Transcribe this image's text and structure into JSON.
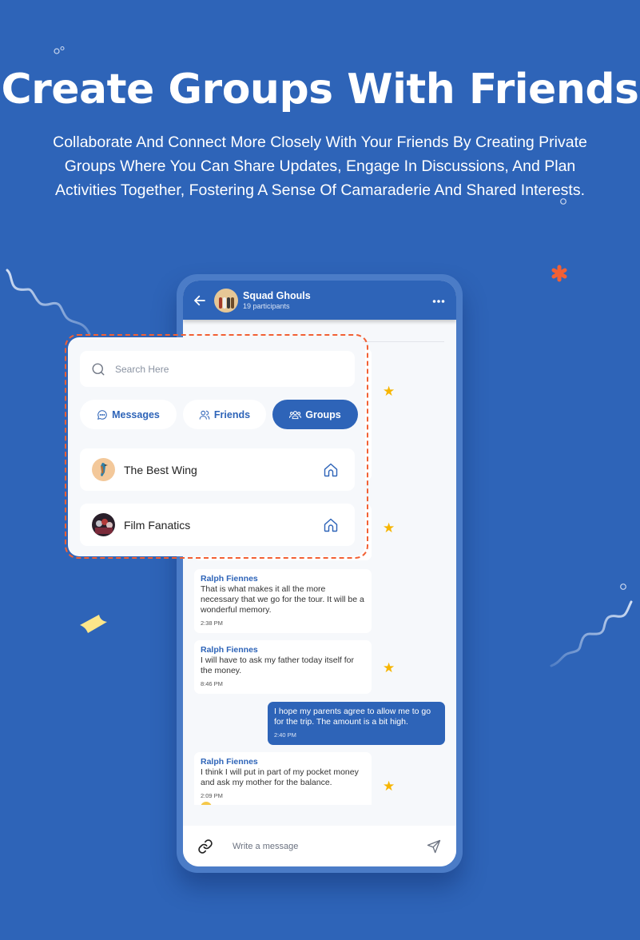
{
  "hero": {
    "title": "Create Groups With Friends",
    "subtitle": "Collaborate And Connect More Closely With Your Friends By Creating Private Groups Where You Can Share Updates, Engage In Discussions, And Plan Activities Together, Fostering A Sense Of Camaraderie And Shared Interests."
  },
  "colors": {
    "background": "#2e64b8",
    "primary": "#2e64b8",
    "accent_orange": "#f26034",
    "star": "#f7b500",
    "ticket_yellow": "#fde68a"
  },
  "chat": {
    "header": {
      "title": "Squad Ghouls",
      "subtitle": "19 participants",
      "back_icon": "arrow-left-icon",
      "more_icon": "more-horizontal-icon"
    },
    "messages": [
      {
        "sender": "Ralph Fiennes",
        "text": "That is what makes it all the more necessary that we go for the tour. It will be a wonderful memory.",
        "time": "2:38 PM",
        "direction": "incoming",
        "starred": false
      },
      {
        "sender": "Ralph Fiennes",
        "text": "I will have to ask my father today itself for the money.",
        "time": "8:46 PM",
        "direction": "incoming",
        "starred": true
      },
      {
        "sender": "",
        "text": "I hope my parents agree to allow me to go for the trip. The amount is a bit high.",
        "time": "2:40 PM",
        "direction": "outgoing",
        "starred": false
      },
      {
        "sender": "Ralph Fiennes",
        "text": "I think I will put in part of my pocket money and ask my mother for the balance.",
        "time": "2:09 PM",
        "direction": "incoming",
        "starred": true,
        "reaction": "emoji"
      }
    ],
    "composer": {
      "placeholder": "Write a message",
      "attach_icon": "link-icon",
      "send_icon": "send-icon"
    }
  },
  "panel": {
    "search_placeholder": "Search Here",
    "tabs": [
      {
        "label": "Messages",
        "icon": "chat-bubble-icon",
        "active": false
      },
      {
        "label": "Friends",
        "icon": "users-icon",
        "active": false
      },
      {
        "label": "Groups",
        "icon": "group-icon",
        "active": true
      }
    ],
    "groups": [
      {
        "name": "The Best Wing",
        "icon": "home-icon"
      },
      {
        "name": "Film Fanatics",
        "icon": "home-icon"
      }
    ]
  }
}
